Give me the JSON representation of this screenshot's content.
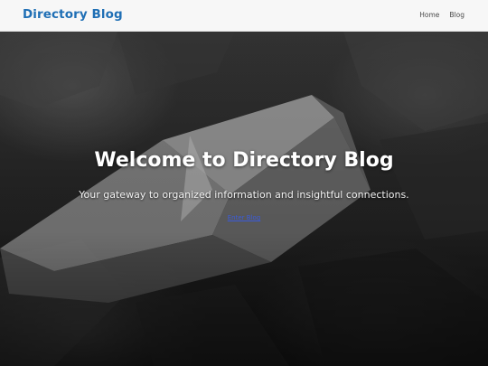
{
  "navbar": {
    "brand": "Directory Blog",
    "links": [
      {
        "label": "Home"
      },
      {
        "label": "Blog"
      }
    ]
  },
  "hero": {
    "title": "Welcome to Directory Blog",
    "subtitle": "Your gateway to organized information and insightful connections.",
    "link_label": "Enter Blog",
    "background": "grayscale photo of a folded paper boat on crumpled paper"
  },
  "colors": {
    "brand": "#1f6fb5",
    "navbar_bg": "#f7f7f7",
    "link": "#3b5bd9"
  }
}
